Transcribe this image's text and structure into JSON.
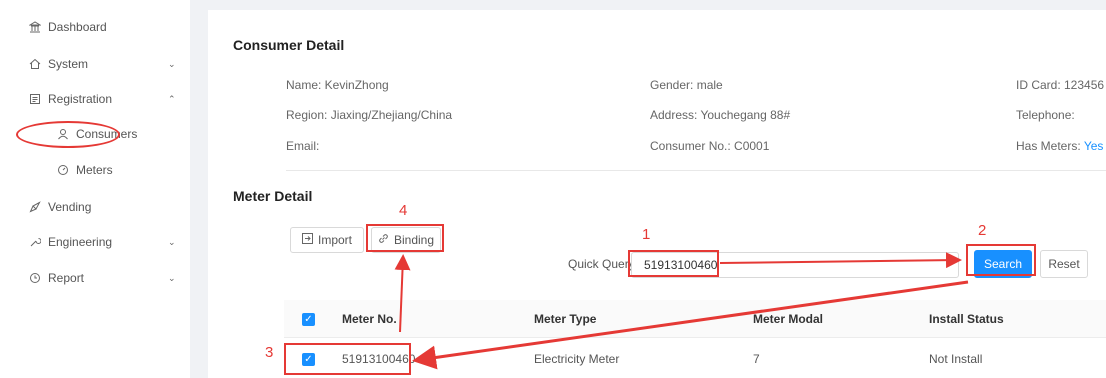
{
  "sidebar": {
    "items": [
      {
        "label": "Dashboard",
        "icon": "bank-icon"
      },
      {
        "label": "System",
        "icon": "home-icon"
      },
      {
        "label": "Registration",
        "icon": "form-icon"
      },
      {
        "label": "Consumers",
        "icon": "user-icon"
      },
      {
        "label": "Meters",
        "icon": "dashboard-gauge-icon"
      },
      {
        "label": "Vending",
        "icon": "compass-icon"
      },
      {
        "label": "Engineering",
        "icon": "tool-icon"
      },
      {
        "label": "Report",
        "icon": "clock-icon"
      }
    ]
  },
  "consumer": {
    "title": "Consumer Detail",
    "name": "Name: KevinZhong",
    "gender": "Gender: male",
    "id_card": "ID Card: 123456",
    "region": "Region: Jiaxing/Zhejiang/China",
    "address": "Address: Youchegang 88#",
    "telephone": "Telephone:",
    "email": "Email:",
    "consumer_no": "Consumer No.: C0001",
    "has_meters_label": "Has Meters:",
    "has_meters_value": "Yes"
  },
  "meter": {
    "title": "Meter Detail",
    "import_label": "Import",
    "binding_label": "Binding",
    "quick_query_label": "Quick Query:",
    "quick_query_value": "51913100460",
    "search_label": "Search",
    "reset_label": "Reset",
    "columns": [
      "Meter No.",
      "Meter Type",
      "Meter Modal",
      "Install Status"
    ],
    "rows": [
      {
        "meter_no": "51913100460",
        "meter_type": "Electricity Meter",
        "meter_modal": "7",
        "install_status": "Not Install"
      }
    ]
  },
  "annotations": {
    "n1": "1",
    "n2": "2",
    "n3": "3",
    "n4": "4"
  },
  "colors": {
    "primary": "#1890ff",
    "annotation": "#e53935"
  }
}
